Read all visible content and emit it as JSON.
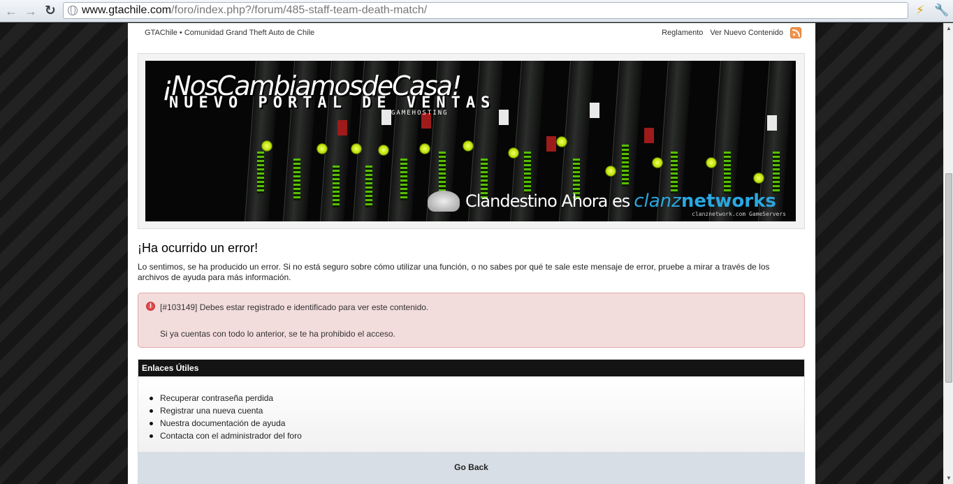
{
  "browser": {
    "url_host": "www.gtachile.com",
    "url_path": "/foro/index.php?/forum/485-staff-team-death-match/",
    "icons": [
      "back-arrow-icon",
      "forward-arrow-icon",
      "reload-icon",
      "globe-icon",
      "lightning-extension-icon",
      "wrench-icon"
    ]
  },
  "header": {
    "site_title": "GTAChile • Comunidad Grand Theft Auto de Chile",
    "links": [
      "Reglamento",
      "Ver Nuevo Contenido"
    ]
  },
  "banner": {
    "headline": "¡NosCambiamosdeCasa!",
    "subheadline": "NUEVO PORTAL DE VENTAS",
    "tag": "GAMEHOSTING",
    "bottom_text": "Clandestino Ahora es",
    "brand_a": "clanz",
    "brand_b": "networks",
    "small_text": "clanznetwork.com GameServers"
  },
  "error": {
    "title": "¡Ha ocurrido un error!",
    "description": "Lo sentimos, se ha producido un error. Si no está seguro sobre cómo utilizar una función, o no sabes por qué te sale este mensaje de error, pruebe a mirar a través de los archivos de ayuda para más información.",
    "message": "[#103149] Debes estar registrado e identificado para ver este contenido.",
    "message2": "Si ya cuentas con todo lo anterior, se te ha prohibido el acceso."
  },
  "useful_links": {
    "title": "Enlaces Útiles",
    "items": [
      "Recuperar contraseña perdida",
      "Registrar una nueva cuenta",
      "Nuestra documentación de ayuda",
      "Contacta con el administrador del foro"
    ],
    "go_back": "Go Back"
  },
  "colors": {
    "error_bg": "#f3dcdc",
    "error_border": "#e2a8a8",
    "links_head_bg": "#141414",
    "go_back_bg": "#d7dee5",
    "brand_blue": "#2aa7e0"
  }
}
